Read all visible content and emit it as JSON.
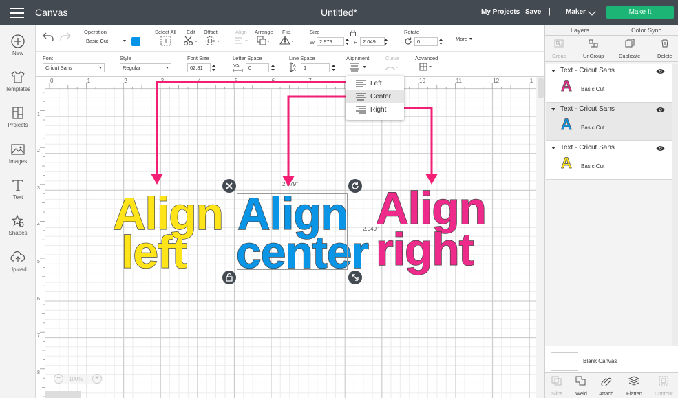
{
  "topbar": {
    "app_name": "Canvas",
    "doc_title": "Untitled*",
    "my_projects": "My Projects",
    "save": "Save",
    "separator": "|",
    "machine": "Maker",
    "make_it": "Make It"
  },
  "leftnav": [
    {
      "label": "New",
      "icon": "plus-circle-icon"
    },
    {
      "label": "Templates",
      "icon": "tshirt-icon"
    },
    {
      "label": "Projects",
      "icon": "projects-icon"
    },
    {
      "label": "Images",
      "icon": "images-icon"
    },
    {
      "label": "Text",
      "icon": "text-icon"
    },
    {
      "label": "Shapes",
      "icon": "shapes-icon"
    },
    {
      "label": "Upload",
      "icon": "upload-icon"
    }
  ],
  "toolbar1": {
    "operation_label": "Operation",
    "operation_value": "Basic Cut",
    "operation_color": "#0093e6",
    "select_all": "Select All",
    "edit": "Edit",
    "offset": "Offset",
    "align": "Align",
    "arrange": "Arrange",
    "flip": "Flip",
    "size": "Size",
    "w_label": "W",
    "w_value": "2.979",
    "h_label": "H",
    "h_value": "2.049",
    "rotate": "Rotate",
    "rotate_value": "0",
    "more": "More"
  },
  "toolbar2": {
    "font_label": "Font",
    "font_value": "Cricut Sans",
    "style_label": "Style",
    "style_value": "Regular",
    "font_size_label": "Font Size",
    "font_size_value": "62.81",
    "letter_space_label": "Letter Space",
    "letter_space_value": "0",
    "line_space_label": "Line Space",
    "line_space_value": "1",
    "alignment_label": "Alignment",
    "curve_label": "Curve",
    "advanced_label": "Advanced"
  },
  "ruler": {
    "top": [
      "0",
      "1",
      "2",
      "3",
      "4",
      "5",
      "6",
      "7",
      "8",
      "9",
      "10",
      "11",
      "12",
      "1"
    ],
    "left": [
      "1",
      "2",
      "3",
      "4",
      "5",
      "6",
      "7",
      "8"
    ]
  },
  "alignment_menu": {
    "items": [
      "Left",
      "Center",
      "Right"
    ],
    "selected": "Center"
  },
  "canvas_text": {
    "left": [
      "Align",
      "left"
    ],
    "center": [
      "Align",
      "center"
    ],
    "right": [
      "Align",
      "right"
    ]
  },
  "colors": {
    "yellow": "#ffe419",
    "blue": "#0a95e7",
    "pink": "#ee2a8b",
    "arrow": "#f21f74",
    "make_it": "#1db576",
    "topbar": "#434a52"
  },
  "selection": {
    "width_label": "2.979\"",
    "height_label": "2.049\""
  },
  "zoom": {
    "minus": "−",
    "value": "100%",
    "plus": "+"
  },
  "right_panel": {
    "tabs": [
      "Layers",
      "Color Sync"
    ],
    "actions": [
      "Group",
      "UnGroup",
      "Duplicate",
      "Delete"
    ],
    "layers": [
      {
        "name": "Text - Cricut Sans",
        "type": "Basic Cut",
        "color": "#ee2a8b"
      },
      {
        "name": "Text - Cricut Sans",
        "type": "Basic Cut",
        "color": "#0a95e7"
      },
      {
        "name": "Text - Cricut Sans",
        "type": "Basic Cut",
        "color": "#ffe419"
      }
    ],
    "blank_canvas": "Blank Canvas",
    "bottom_actions": [
      "Slice",
      "Weld",
      "Attach",
      "Flatten",
      "Contour"
    ]
  }
}
